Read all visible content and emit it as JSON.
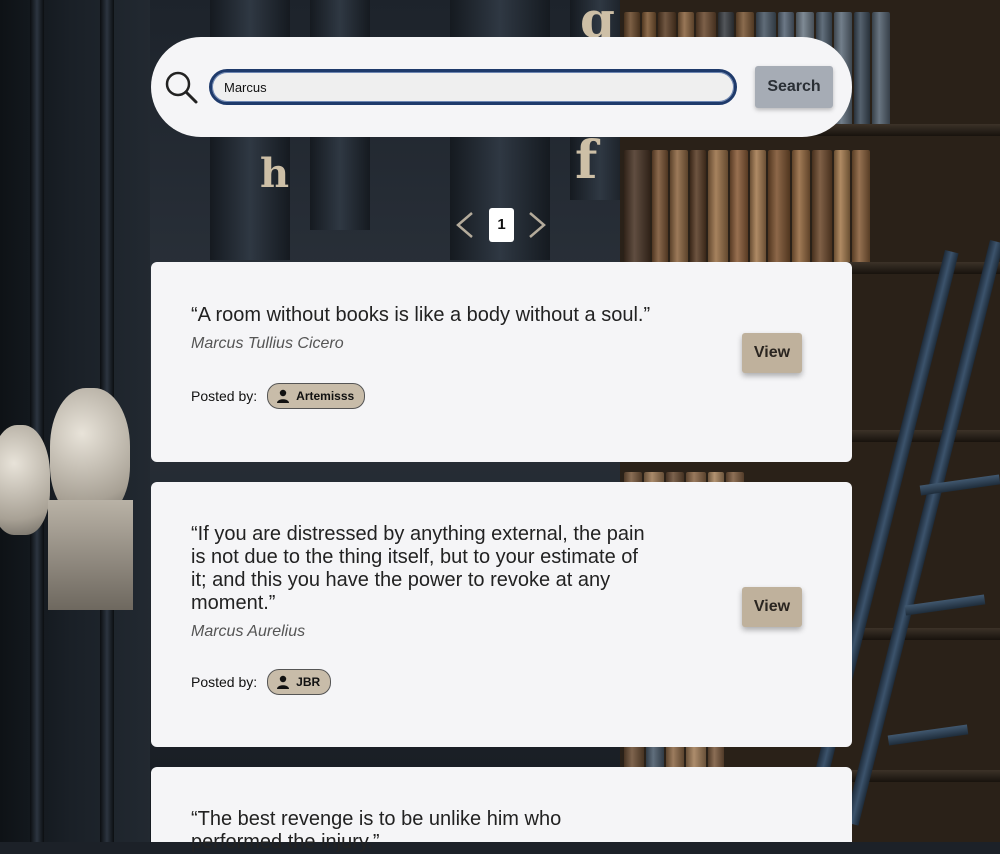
{
  "search": {
    "value": "Marcus",
    "button_label": "Search"
  },
  "pagination": {
    "current_page": "1"
  },
  "quotes": [
    {
      "text": "“A room without books is like a body without a soul.”",
      "author": "Marcus Tullius Cicero",
      "posted_by_label": "Posted by:",
      "user": "Artemisss",
      "view_label": "View"
    },
    {
      "text": "“If you are distressed by anything external, the pain is not due to the thing itself, but to your estimate of it; and this you have the power to revoke at any moment.”",
      "author": "Marcus Aurelius",
      "posted_by_label": "Posted by:",
      "user": "JBR",
      "view_label": "View"
    },
    {
      "text": "“The best revenge is to be unlike him who performed the injury.”"
    }
  ],
  "colors": {
    "card_background": "#f5f5f7",
    "view_button": "#bfb19c",
    "user_chip": "#c8bca9",
    "search_button": "#a6acb5",
    "input_border": "#1e3a6b"
  },
  "icons": [
    "search-icon",
    "chevron-left-icon",
    "chevron-right-icon",
    "user-icon"
  ]
}
